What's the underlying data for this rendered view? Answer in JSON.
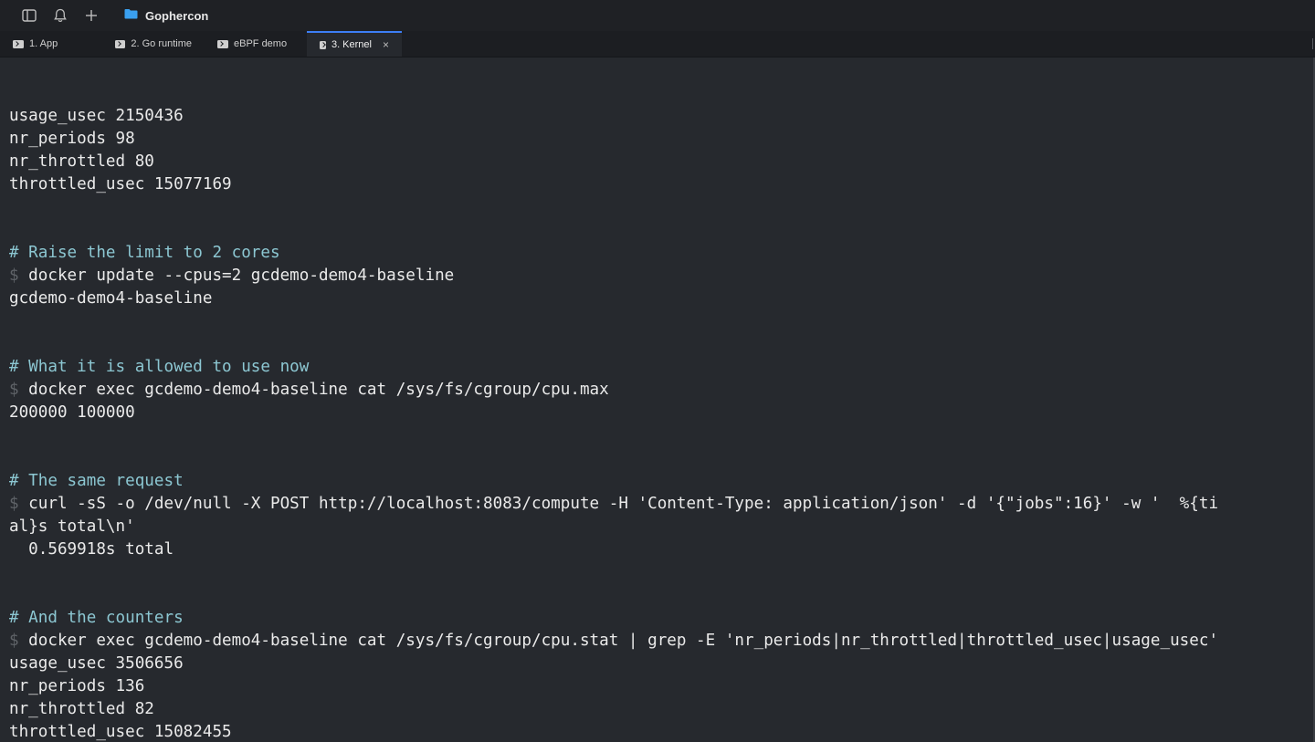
{
  "window": {
    "folder_title": "Gophercon",
    "icons": [
      "sidebar-toggle-icon",
      "bell-icon",
      "plus-icon",
      "folder-icon"
    ]
  },
  "tabs": [
    {
      "label": "1. App"
    },
    {
      "label": "2. Go runtime"
    },
    {
      "label": "eBPF demo"
    },
    {
      "label": "3. Kernel",
      "active": true,
      "close": "×"
    }
  ],
  "terminal": {
    "prompt_symbol": "$",
    "lines": [
      {
        "kind": "output",
        "text": "usage_usec 2150436"
      },
      {
        "kind": "output",
        "text": "nr_periods 98"
      },
      {
        "kind": "output",
        "text": "nr_throttled 80"
      },
      {
        "kind": "output",
        "text": "throttled_usec 15077169"
      },
      {
        "kind": "blank",
        "text": ""
      },
      {
        "kind": "blank",
        "text": ""
      },
      {
        "kind": "comment",
        "text": "# Raise the limit to 2 cores"
      },
      {
        "kind": "command",
        "text": " docker update --cpus=2 gcdemo-demo4-baseline"
      },
      {
        "kind": "output",
        "text": "gcdemo-demo4-baseline"
      },
      {
        "kind": "blank",
        "text": ""
      },
      {
        "kind": "blank",
        "text": ""
      },
      {
        "kind": "comment",
        "text": "# What it is allowed to use now"
      },
      {
        "kind": "command",
        "text": " docker exec gcdemo-demo4-baseline cat /sys/fs/cgroup/cpu.max"
      },
      {
        "kind": "output",
        "text": "200000 100000"
      },
      {
        "kind": "blank",
        "text": ""
      },
      {
        "kind": "blank",
        "text": ""
      },
      {
        "kind": "comment",
        "text": "# The same request"
      },
      {
        "kind": "command",
        "text": " curl -sS -o /dev/null -X POST http://localhost:8083/compute -H 'Content-Type: application/json' -d '{\"jobs\":16}' -w '  %{ti"
      },
      {
        "kind": "output",
        "text": "al}s total\\n'"
      },
      {
        "kind": "output",
        "text": "  0.569918s total"
      },
      {
        "kind": "blank",
        "text": ""
      },
      {
        "kind": "blank",
        "text": ""
      },
      {
        "kind": "comment",
        "text": "# And the counters"
      },
      {
        "kind": "command",
        "text": " docker exec gcdemo-demo4-baseline cat /sys/fs/cgroup/cpu.stat | grep -E 'nr_periods|nr_throttled|throttled_usec|usage_usec'"
      },
      {
        "kind": "output",
        "text": "usage_usec 3506656"
      },
      {
        "kind": "output",
        "text": "nr_periods 136"
      },
      {
        "kind": "output",
        "text": "nr_throttled 82"
      },
      {
        "kind": "output",
        "text": "throttled_usec 15082455"
      }
    ]
  }
}
